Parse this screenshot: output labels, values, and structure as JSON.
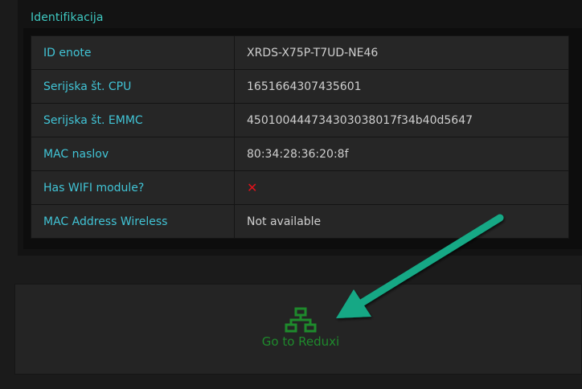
{
  "identification": {
    "title": "Identifikacija",
    "rows": [
      {
        "label": "ID enote",
        "value": "XRDS-X75P-T7UD-NE46"
      },
      {
        "label": "Serijska št. CPU",
        "value": "1651664307435601"
      },
      {
        "label": "Serijska št. EMMC",
        "value": "450100444734303038017f34b40d5647"
      },
      {
        "label": "MAC naslov",
        "value": "80:34:28:36:20:8f"
      },
      {
        "label": "Has WIFI module?",
        "value": "✕"
      },
      {
        "label": "MAC Address Wireless",
        "value": "Not available"
      }
    ]
  },
  "reduxi": {
    "icon": "network-icon",
    "label": "Go to Reduxi"
  },
  "colors": {
    "label_text": "#41c4d6",
    "title_text": "#3fc9c2",
    "value_text": "#cfcfcf",
    "status_no": "#e0121b",
    "reduxi_green": "#1e8a2c",
    "arrow": "#12a885"
  }
}
